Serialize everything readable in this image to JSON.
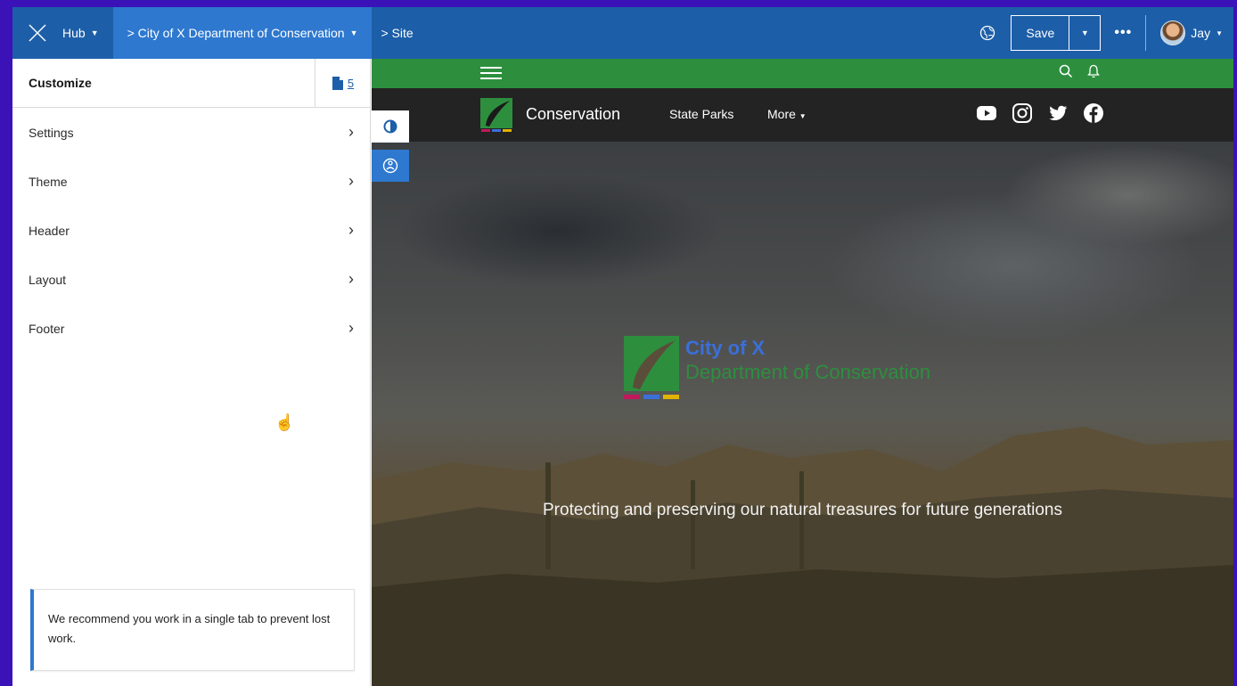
{
  "topbar": {
    "hub_label": "Hub",
    "breadcrumb_active": "> City of X Department of Conservation",
    "breadcrumb_site": "> Site",
    "save_label": "Save",
    "more_label": "•••",
    "user_name": "Jay"
  },
  "panel": {
    "title": "Customize",
    "pages_count": "5",
    "items": [
      {
        "label": "Settings"
      },
      {
        "label": "Theme"
      },
      {
        "label": "Header"
      },
      {
        "label": "Layout"
      },
      {
        "label": "Footer"
      }
    ],
    "notice": "We recommend you work in a single tab to prevent lost work."
  },
  "preview": {
    "site_name": "Conservation",
    "nav": [
      "State Parks",
      "More"
    ],
    "social": [
      "youtube-icon",
      "instagram-icon",
      "twitter-icon",
      "facebook-icon"
    ],
    "hero_city": "City of X",
    "hero_department": "Department of Conservation",
    "hero_tagline": "Protecting and preserving our natural treasures for future generations"
  },
  "colors": {
    "topbar": "#1d5ea8",
    "topbar_active": "#2e78cf",
    "green_bar": "#2d8f3e",
    "dark_header": "#232323",
    "outer_background": "#3a12b8"
  }
}
